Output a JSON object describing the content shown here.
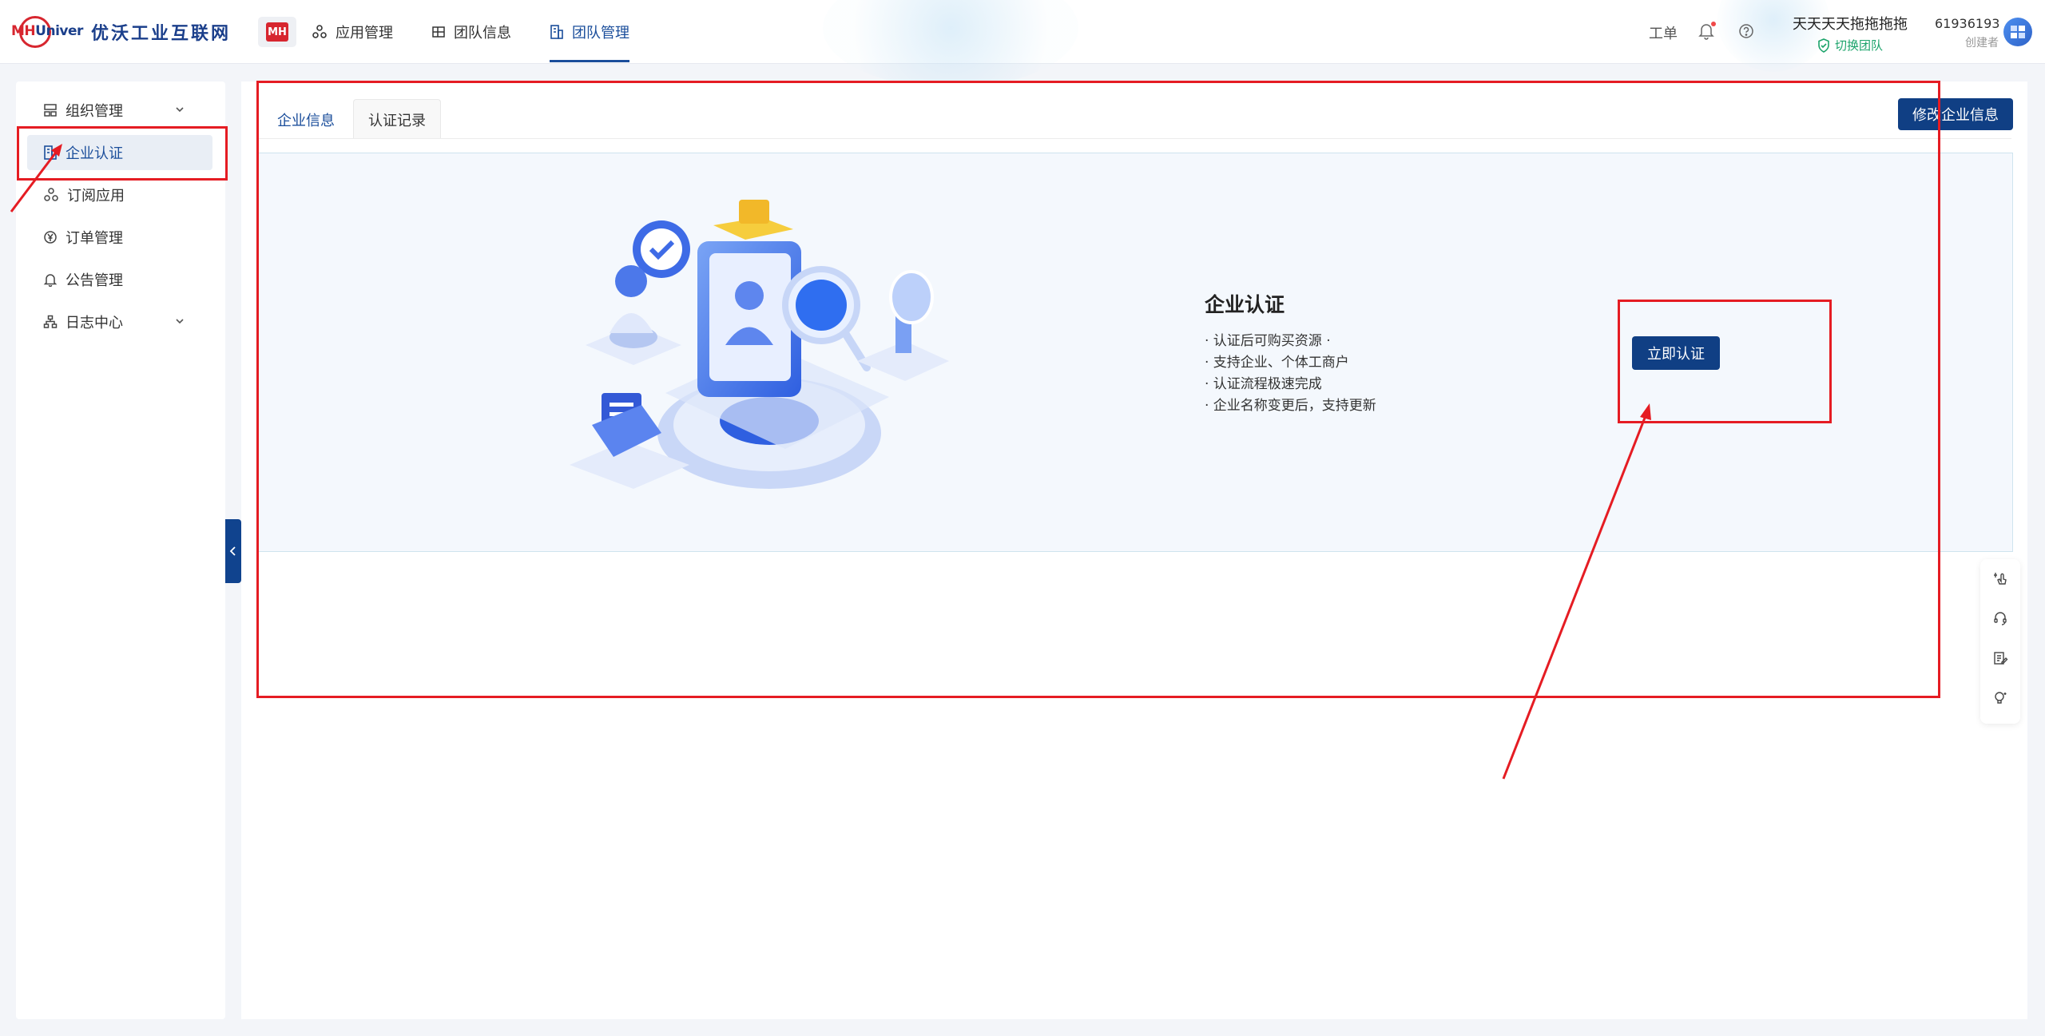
{
  "header": {
    "logo_mark_red": "MH",
    "logo_mark_blue": "Univer",
    "brand_name": "优沃工业互联网",
    "app_badge": "MH",
    "nav": [
      {
        "label": "应用管理",
        "icon": "apps-icon"
      },
      {
        "label": "团队信息",
        "icon": "team-info-icon"
      },
      {
        "label": "团队管理",
        "icon": "team-manage-icon",
        "active": true
      }
    ],
    "ticket_label": "工单",
    "team_name": "天天天天拖拖拖拖",
    "switch_team_label": "切换团队",
    "user_id": "61936193",
    "user_role": "创建者"
  },
  "sidebar": {
    "items": [
      {
        "label": "组织管理",
        "icon": "org-icon",
        "expandable": true
      },
      {
        "label": "企业认证",
        "icon": "building-icon",
        "active": true
      },
      {
        "label": "订阅应用",
        "icon": "subscribe-icon"
      },
      {
        "label": "订单管理",
        "icon": "yen-icon"
      },
      {
        "label": "公告管理",
        "icon": "bell-icon"
      },
      {
        "label": "日志中心",
        "icon": "log-icon",
        "expandable": true
      }
    ]
  },
  "main": {
    "tabs": [
      {
        "label": "企业信息",
        "active": true
      },
      {
        "label": "认证记录"
      }
    ],
    "edit_button": "修改企业信息",
    "cert": {
      "title": "企业认证",
      "points": [
        "· 认证后可购买资源 ·",
        "· 支持企业、个体工商户",
        "· 认证流程极速完成",
        "· 企业名称变更后，支持更新"
      ],
      "button": "立即认证"
    }
  },
  "colors": {
    "primary": "#103f84",
    "accent_red": "#d7262f",
    "annotation_red": "#e51c23",
    "success_green": "#1aa36a"
  }
}
